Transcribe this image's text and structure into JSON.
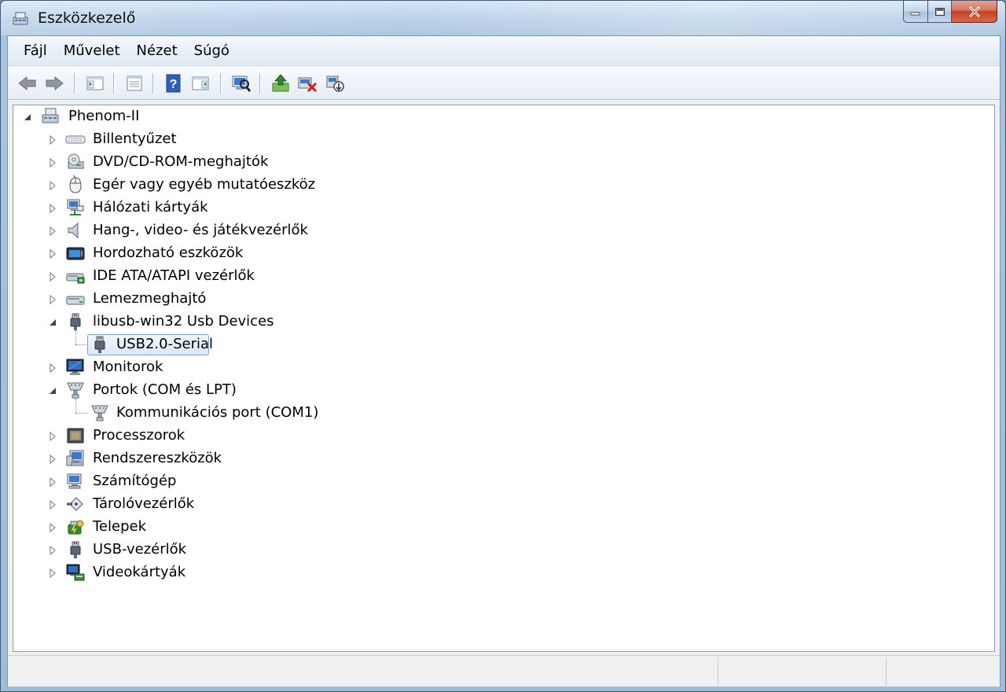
{
  "window": {
    "title": "Eszközkezelő"
  },
  "menu": {
    "file": "Fájl",
    "action": "Művelet",
    "view": "Nézet",
    "help": "Súgó"
  },
  "toolbar": {
    "buttons": [
      "back-icon",
      "forward-icon",
      "show-hide-console-tree-icon",
      "properties-icon",
      "help-icon",
      "show-action-pane-icon",
      "scan-hardware-icon",
      "update-driver-icon",
      "uninstall-icon",
      "disable-icon"
    ]
  },
  "tree": {
    "root": "Phenom-II",
    "items": [
      {
        "label": "Billentyűzet",
        "icon": "keyboard-icon"
      },
      {
        "label": "DVD/CD-ROM-meghajtók",
        "icon": "dvd-drive-icon"
      },
      {
        "label": "Egér vagy egyéb mutatóeszköz",
        "icon": "mouse-icon"
      },
      {
        "label": "Hálózati kártyák",
        "icon": "network-adapter-icon"
      },
      {
        "label": "Hang-, video- és játékvezérlők",
        "icon": "speaker-icon"
      },
      {
        "label": "Hordozható eszközök",
        "icon": "portable-device-icon"
      },
      {
        "label": "IDE ATA/ATAPI vezérlők",
        "icon": "ide-controller-icon"
      },
      {
        "label": "Lemezmeghajtó",
        "icon": "disk-drive-icon"
      },
      {
        "label": "libusb-win32 Usb Devices",
        "icon": "usb-plug-icon",
        "expanded": true,
        "children": [
          {
            "label": "USB2.0-Serial",
            "icon": "usb-plug-icon",
            "selected": true
          }
        ]
      },
      {
        "label": "Monitorok",
        "icon": "monitor-icon"
      },
      {
        "label": "Portok (COM és LPT)",
        "icon": "port-connector-icon",
        "expanded": true,
        "children": [
          {
            "label": "Kommunikációs port (COM1)",
            "icon": "port-connector-icon"
          }
        ]
      },
      {
        "label": "Processzorok",
        "icon": "processor-icon"
      },
      {
        "label": "Rendszereszközök",
        "icon": "system-device-icon"
      },
      {
        "label": "Számítógép",
        "icon": "computer-icon"
      },
      {
        "label": "Tárolóvezérlők",
        "icon": "storage-controller-icon"
      },
      {
        "label": "Telepek",
        "icon": "battery-icon"
      },
      {
        "label": "USB-vezérlők",
        "icon": "usb-plug-icon"
      },
      {
        "label": "Videokártyák",
        "icon": "display-adapter-icon"
      }
    ]
  },
  "statusbar": {
    "left": "",
    "middle": "",
    "right": ""
  }
}
